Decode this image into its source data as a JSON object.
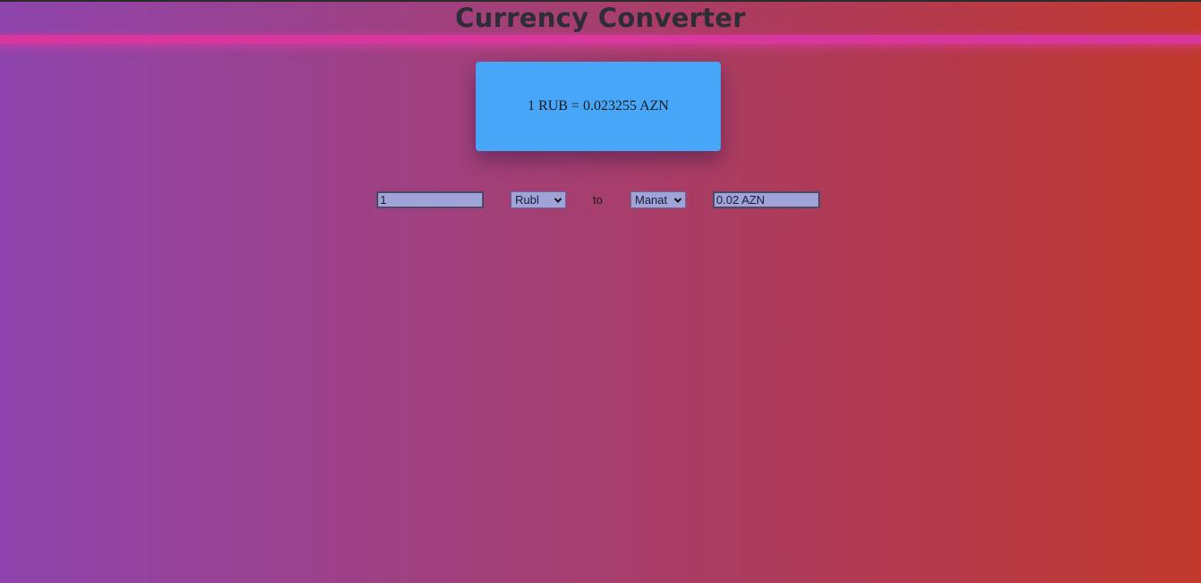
{
  "header": {
    "title": "Currency Converter"
  },
  "rate_card": {
    "text": "1 RUB = 0.023255 AZN"
  },
  "converter": {
    "amount_value": "1",
    "from_currency": "Rubl",
    "separator": "to",
    "to_currency": "Manat",
    "result_value": "0.02 AZN"
  },
  "colors": {
    "gradient_left": "#8e44ad",
    "gradient_right": "#c0392b",
    "card_background": "#48a6f9",
    "glow_line": "#d9369e",
    "field_background": "#9fa3d8"
  },
  "icons": {
    "select_arrow": "chevron-down-icon"
  }
}
